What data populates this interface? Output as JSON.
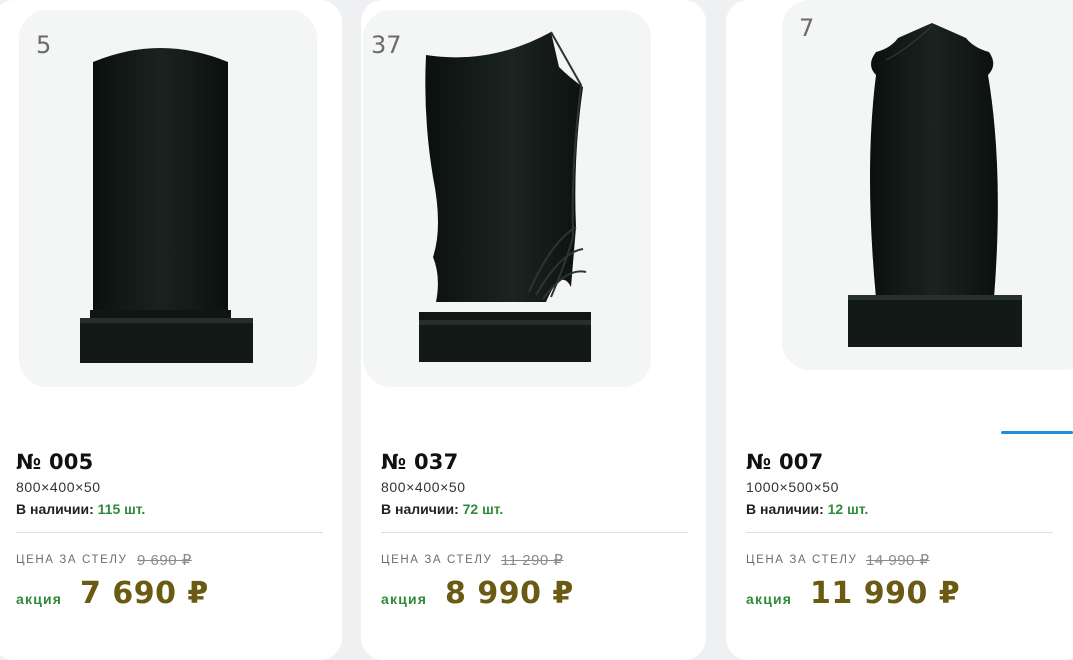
{
  "products": [
    {
      "badge": "5",
      "title": "№ 005",
      "dimensions": "800×400×50",
      "stock_label": "В наличии:",
      "stock_qty": "115 шт.",
      "price_label": "ЦЕНА ЗА СТЕЛУ",
      "old_price": "9 690 ₽",
      "promo_label": "акция",
      "promo_price": "7 690 ₽"
    },
    {
      "badge": "37",
      "title": "№ 037",
      "dimensions": "800×400×50",
      "stock_label": "В наличии:",
      "stock_qty": "72 шт.",
      "price_label": "ЦЕНА ЗА СТЕЛУ",
      "old_price": "11 290 ₽",
      "promo_label": "акция",
      "promo_price": "8 990 ₽"
    },
    {
      "badge": "7",
      "title": "№ 007",
      "dimensions": "1000×500×50",
      "stock_label": "В наличии:",
      "stock_qty": "12 шт.",
      "price_label": "ЦЕНА ЗА СТЕЛУ",
      "old_price": "14 990 ₽",
      "promo_label": "акция",
      "promo_price": "11 990 ₽"
    }
  ],
  "colors": {
    "accent_green": "#2f8a3a",
    "price_gold": "#6b5a12",
    "stone": "#101512"
  }
}
